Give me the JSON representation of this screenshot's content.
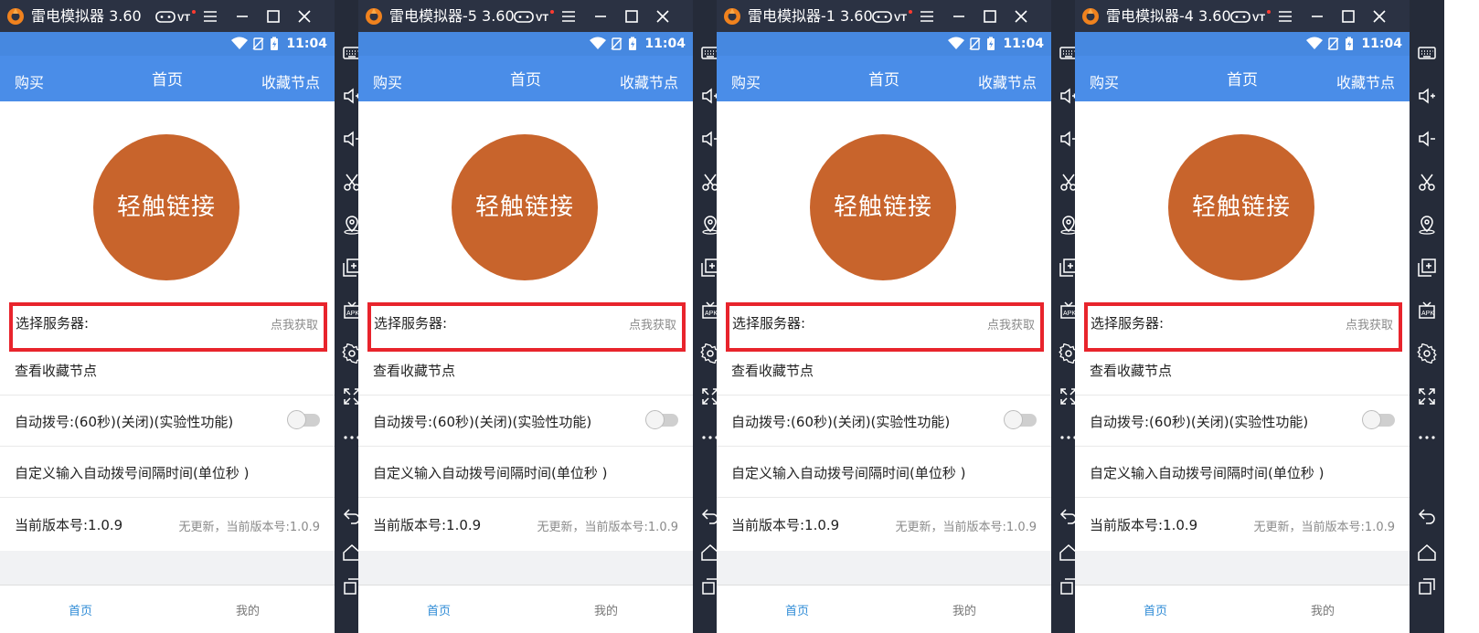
{
  "windows": [
    {
      "title": "雷电模拟器 3.60",
      "status_time": "11:04",
      "appbar": {
        "buy": "购买",
        "home": "首页",
        "favorites": "收藏节点"
      },
      "main_button": "轻触链接",
      "rows": {
        "server_label": "选择服务器:",
        "server_action": "点我获取",
        "view_favorites": "查看收藏节点",
        "auto_dial": "自动拨号:(60秒)(关闭)(实验性功能)",
        "custom_interval": "自定义输入自动拨号间隔时间(单位秒 )",
        "version_label": "当前版本号:1.0.9",
        "version_status": "无更新，当前版本号:1.0.9"
      },
      "nav": {
        "home": "首页",
        "mine": "我的"
      }
    },
    {
      "title": "雷电模拟器-5 3.60",
      "status_time": "11:04",
      "appbar": {
        "buy": "购买",
        "home": "首页",
        "favorites": "收藏节点"
      },
      "main_button": "轻触链接",
      "rows": {
        "server_label": "选择服务器:",
        "server_action": "点我获取",
        "view_favorites": "查看收藏节点",
        "auto_dial": "自动拨号:(60秒)(关闭)(实验性功能)",
        "custom_interval": "自定义输入自动拨号间隔时间(单位秒 )",
        "version_label": "当前版本号:1.0.9",
        "version_status": "无更新，当前版本号:1.0.9"
      },
      "nav": {
        "home": "首页",
        "mine": "我的"
      }
    },
    {
      "title": "雷电模拟器-1 3.60",
      "status_time": "11:04",
      "appbar": {
        "buy": "购买",
        "home": "首页",
        "favorites": "收藏节点"
      },
      "main_button": "轻触链接",
      "rows": {
        "server_label": "选择服务器:",
        "server_action": "点我获取",
        "view_favorites": "查看收藏节点",
        "auto_dial": "自动拨号:(60秒)(关闭)(实验性功能)",
        "custom_interval": "自定义输入自动拨号间隔时间(单位秒 )",
        "version_label": "当前版本号:1.0.9",
        "version_status": "无更新，当前版本号:1.0.9"
      },
      "nav": {
        "home": "首页",
        "mine": "我的"
      }
    },
    {
      "title": "雷电模拟器-4 3.60",
      "status_time": "11:04",
      "appbar": {
        "buy": "购买",
        "home": "首页",
        "favorites": "收藏节点"
      },
      "main_button": "轻触链接",
      "rows": {
        "server_label": "选择服务器:",
        "server_action": "点我获取",
        "view_favorites": "查看收藏节点",
        "auto_dial": "自动拨号:(60秒)(关闭)(实验性功能)",
        "custom_interval": "自定义输入自动拨号间隔时间(单位秒 )",
        "version_label": "当前版本号:1.0.9",
        "version_status": "无更新，当前版本号:1.0.9"
      },
      "nav": {
        "home": "首页",
        "mine": "我的"
      }
    }
  ],
  "window_controls": [
    "gamepad-vt-icon",
    "menu-icon",
    "minimize-icon",
    "maximize-icon",
    "close-icon",
    "collapse-sidebar-icon"
  ],
  "status_icons": [
    "wifi-icon",
    "no-sim-icon",
    "battery-charging-icon"
  ],
  "sidebar_icons": [
    "keyboard-icon",
    "volume-up-icon",
    "volume-down-icon",
    "screenshot-scissors-icon",
    "location-icon",
    "multi-instance-icon",
    "install-apk-icon",
    "settings-icon",
    "fullscreen-icon",
    "more-icon",
    "back-icon",
    "home-icon",
    "recent-apps-icon"
  ],
  "colors": {
    "titlebar": "#2b3243",
    "sidebar": "#252b39",
    "statusbar": "#4688e0",
    "appbar": "#4a8de8",
    "main_button": "#c8642c",
    "highlight_box": "#e8242c",
    "nav_active": "#2e8bd6"
  }
}
